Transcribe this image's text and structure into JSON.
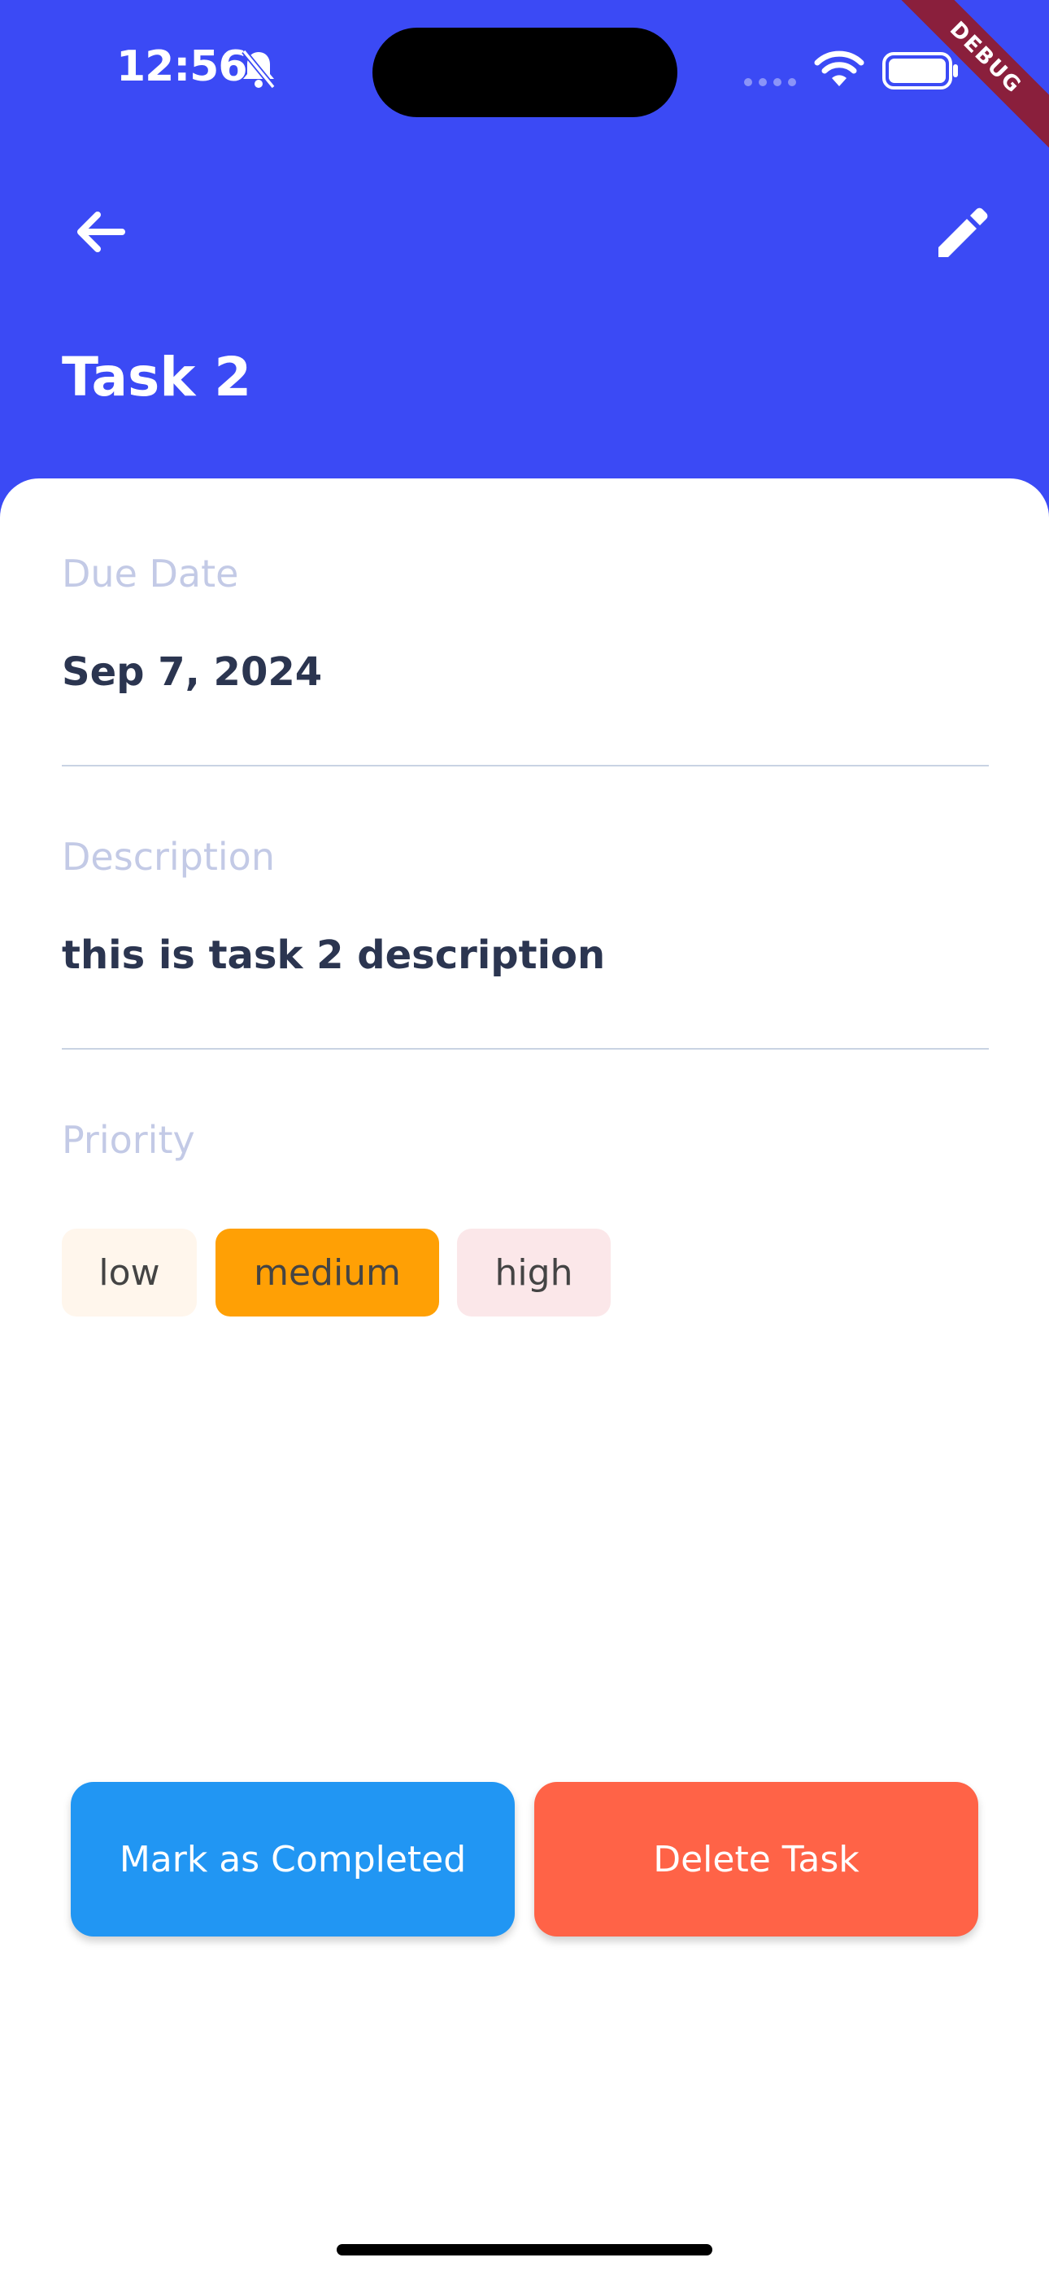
{
  "status_bar": {
    "time": "12:56",
    "icons": [
      "bell-slash-icon",
      "signal-dots-icon",
      "wifi-icon",
      "battery-icon"
    ]
  },
  "debug_banner": "DEBUG",
  "appbar": {
    "back_icon": "arrow-left-icon",
    "edit_icon": "pencil-icon",
    "title": "Task 2"
  },
  "details": {
    "due_date_label": "Due Date",
    "due_date_value": "Sep 7, 2024",
    "description_label": "Description",
    "description_value": "this is task 2 description",
    "priority_label": "Priority"
  },
  "priority_options": [
    {
      "label": "low",
      "color": "#fff6ec",
      "selected": false
    },
    {
      "label": "medium",
      "color": "#ffa005",
      "selected": true
    },
    {
      "label": "high",
      "color": "#fbe7e9",
      "selected": false
    }
  ],
  "actions": {
    "complete_label": "Mark as Completed",
    "complete_color": "#2196f3",
    "delete_label": "Delete Task",
    "delete_color": "#ff6347"
  },
  "colors": {
    "header_bg": "#3b4af5",
    "label_text": "#c3cae6",
    "value_text": "#2b3550"
  }
}
